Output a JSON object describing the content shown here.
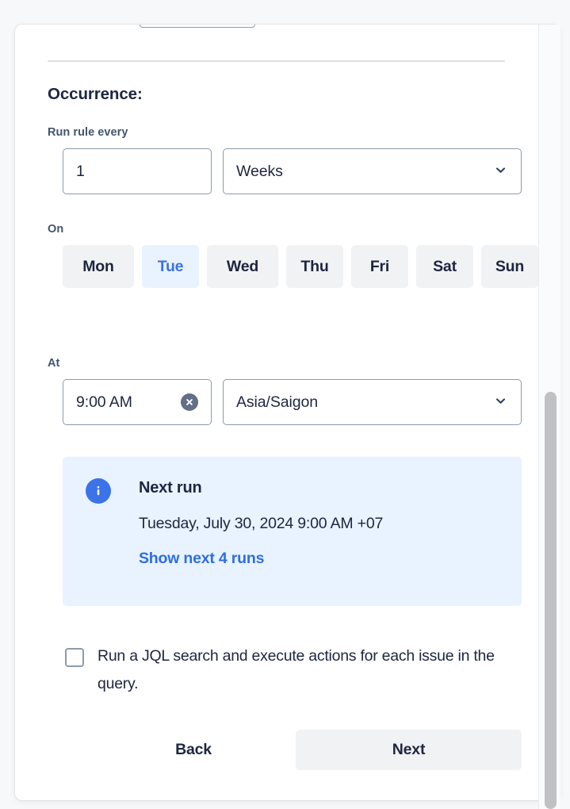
{
  "dialog": {
    "section_heading": "Occurrence:",
    "divider": true,
    "cutoff_field_above": ""
  },
  "form": {
    "run_rule_every": {
      "label": "Run rule every",
      "interval_value": "1",
      "interval_placeholder": "1",
      "unit_value": "Weeks",
      "unit_chevron": "chevron-down-icon"
    },
    "on": {
      "label": "On",
      "days": [
        {
          "label": "Mon",
          "selected": false
        },
        {
          "label": "Tue",
          "selected": true
        },
        {
          "label": "Wed",
          "selected": false
        },
        {
          "label": "Thu",
          "selected": false
        },
        {
          "label": "Fri",
          "selected": false
        },
        {
          "label": "Sat",
          "selected": false
        },
        {
          "label": "Sun",
          "selected": false
        }
      ]
    },
    "at": {
      "label": "At",
      "time_value": "9:00 AM",
      "time_placeholder": "Select time",
      "clear_icon": "clear-circle-icon",
      "timezone_value": "Asia/Saigon",
      "timezone_chevron": "chevron-down-icon"
    }
  },
  "info_panel": {
    "icon": "info-circle-icon",
    "title": "Next run",
    "detail": "Tuesday, July 30, 2024 9:00 AM +07",
    "link_label": "Show next 4 runs"
  },
  "jql_option": {
    "checked": false,
    "label": "Run a JQL search and execute actions for each issue in the query."
  },
  "footer": {
    "back_label": "Back",
    "next_label": "Next"
  },
  "scrollbar": {
    "orientation": "vertical",
    "thumb_color": "#BFC1C4"
  },
  "colors": {
    "accent_blue": "#3B73E8",
    "link_blue": "#2D6FE0",
    "selected_chip_bg": "#E9F2FF",
    "chip_bg": "#F1F2F4",
    "text_dark": "#1D2640",
    "label_gray": "#44546F",
    "border_gray": "#8C9BAB",
    "page_bg": "#F7F8F9"
  }
}
